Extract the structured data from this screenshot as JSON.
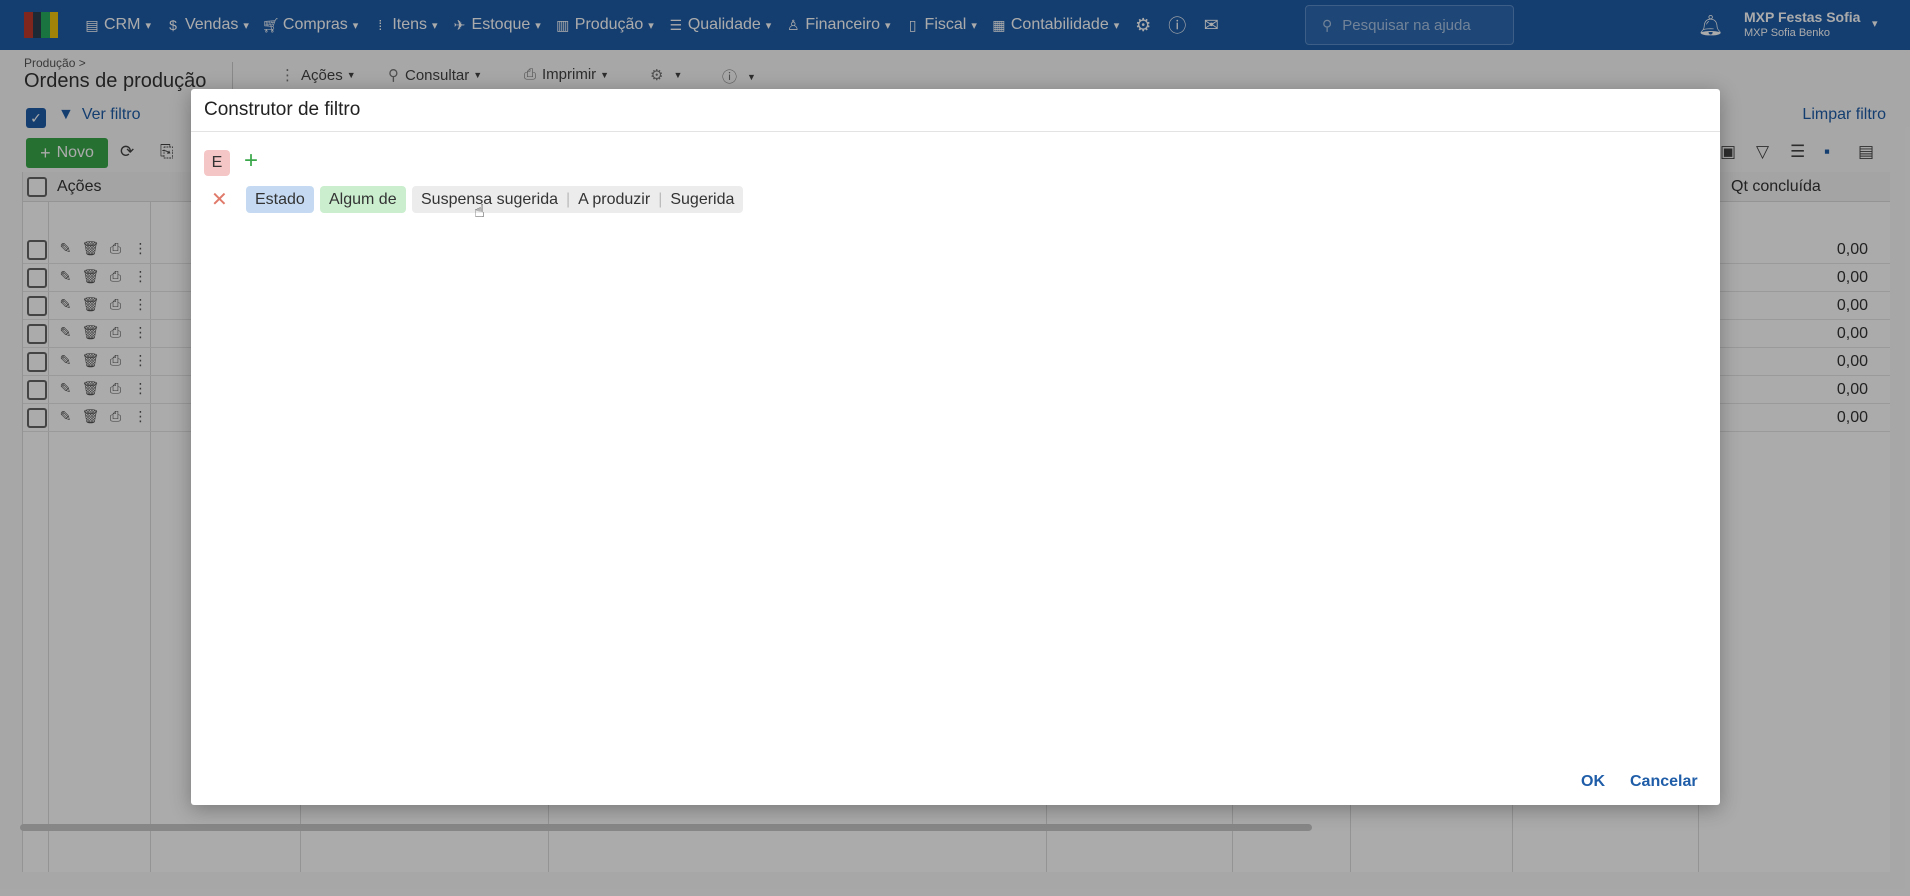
{
  "nav": {
    "items": [
      {
        "label": "CRM",
        "icon": "crm-icon"
      },
      {
        "label": "Vendas",
        "icon": "dollar-icon"
      },
      {
        "label": "Compras",
        "icon": "cart-icon"
      },
      {
        "label": "Itens",
        "icon": "items-icon"
      },
      {
        "label": "Estoque",
        "icon": "stock-icon"
      },
      {
        "label": "Produção",
        "icon": "factory-icon"
      },
      {
        "label": "Qualidade",
        "icon": "quality-icon"
      },
      {
        "label": "Financeiro",
        "icon": "finance-icon"
      },
      {
        "label": "Fiscal",
        "icon": "fiscal-icon"
      },
      {
        "label": "Contabilidade",
        "icon": "ledger-icon"
      }
    ],
    "search_placeholder": "Pesquisar na ajuda",
    "user_name": "MXP Festas Sofia",
    "user_sub": "MXP Sofia Benko"
  },
  "page": {
    "breadcrumb": "Produção >",
    "title": "Ordens de produção",
    "toolbar": {
      "acoes": "Ações",
      "consultar": "Consultar",
      "imprimir": "Imprimir"
    },
    "ver_filtro": "Ver filtro",
    "limpar_filtro": "Limpar filtro",
    "novo": "Novo"
  },
  "grid": {
    "col_acoes": "Ações",
    "col_qt": "Qt concluída",
    "rows": [
      "0,00",
      "0,00",
      "0,00",
      "0,00",
      "0,00",
      "0,00",
      "0,00"
    ]
  },
  "dialog": {
    "title": "Construtor de filtro",
    "group_operator": "E",
    "condition": {
      "field": "Estado",
      "operator": "Algum de",
      "values": [
        "Suspensa sugerida",
        "A produzir",
        "Sugerida"
      ]
    },
    "ok_label": "OK",
    "cancel_label": "Cancelar"
  },
  "colors": {
    "brand": "#1f5da8",
    "green": "#3aa84a",
    "field_chip": "#c5daf2",
    "operator_chip": "#cbeecf"
  }
}
